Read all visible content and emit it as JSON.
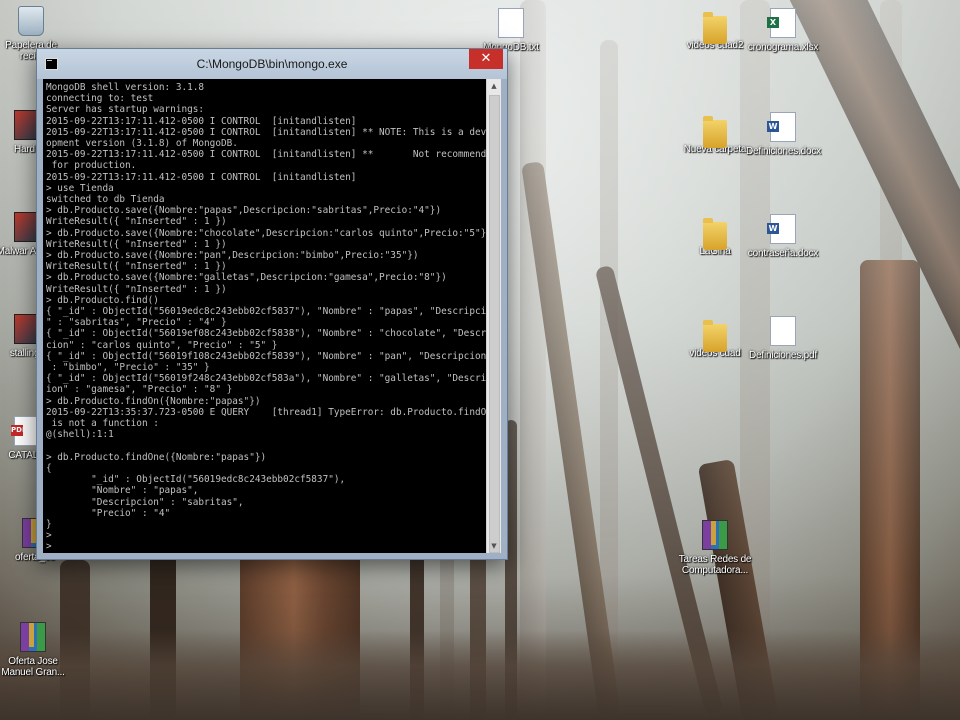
{
  "window": {
    "title": "C:\\MongoDB\\bin\\mongo.exe",
    "close_glyph": "✕",
    "console_lines": [
      "MongoDB shell version: 3.1.8",
      "connecting to: test",
      "Server has startup warnings:",
      "2015-09-22T13:17:11.412-0500 I CONTROL  [initandlisten]",
      "2015-09-22T13:17:11.412-0500 I CONTROL  [initandlisten] ** NOTE: This is a devel",
      "opment version (3.1.8) of MongoDB.",
      "2015-09-22T13:17:11.412-0500 I CONTROL  [initandlisten] **       Not recommended",
      " for production.",
      "2015-09-22T13:17:11.412-0500 I CONTROL  [initandlisten]",
      "> use Tienda",
      "switched to db Tienda",
      "> db.Producto.save({Nombre:\"papas\",Descripcion:\"sabritas\",Precio:\"4\"})",
      "WriteResult({ \"nInserted\" : 1 })",
      "> db.Producto.save({Nombre:\"chocolate\",Descripcion:\"carlos quinto\",Precio:\"5\"})",
      "WriteResult({ \"nInserted\" : 1 })",
      "> db.Producto.save({Nombre:\"pan\",Descripcion:\"bimbo\",Precio:\"35\"})",
      "WriteResult({ \"nInserted\" : 1 })",
      "> db.Producto.save({Nombre:\"galletas\",Descripcion:\"gamesa\",Precio:\"8\"})",
      "WriteResult({ \"nInserted\" : 1 })",
      "> db.Producto.find()",
      "{ \"_id\" : ObjectId(\"56019edc8c243ebb02cf5837\"), \"Nombre\" : \"papas\", \"Descripcion",
      "\" : \"sabritas\", \"Precio\" : \"4\" }",
      "{ \"_id\" : ObjectId(\"56019ef08c243ebb02cf5838\"), \"Nombre\" : \"chocolate\", \"Descrip",
      "cion\" : \"carlos quinto\", \"Precio\" : \"5\" }",
      "{ \"_id\" : ObjectId(\"56019f108c243ebb02cf5839\"), \"Nombre\" : \"pan\", \"Descripcion\"",
      " : \"bimbo\", \"Precio\" : \"35\" }",
      "{ \"_id\" : ObjectId(\"56019f248c243ebb02cf583a\"), \"Nombre\" : \"galletas\", \"Descripc",
      "ion\" : \"gamesa\", \"Precio\" : \"8\" }",
      "> db.Producto.findOn({Nombre:\"papas\"})",
      "2015-09-22T13:35:37.723-0500 E QUERY    [thread1] TypeError: db.Producto.findOn",
      " is not a function :",
      "@(shell):1:1",
      "",
      "> db.Producto.findOne({Nombre:\"papas\"})",
      "{",
      "        \"_id\" : ObjectId(\"56019edc8c243ebb02cf5837\"),",
      "        \"Nombre\" : \"papas\",",
      "        \"Descripcion\" : \"sabritas\",",
      "        \"Precio\" : \"4\"",
      "}",
      "> ",
      "> "
    ]
  },
  "desktop_icons": [
    {
      "label": "Papelera de recicl",
      "type": "bin"
    },
    {
      "label": "Hard I",
      "type": "app"
    },
    {
      "label": "Malwar Anti-M",
      "type": "app"
    },
    {
      "label": "stallings",
      "type": "app"
    },
    {
      "label": "CATALO",
      "type": "pdf"
    },
    {
      "label": "oferta_co",
      "type": "rar"
    },
    {
      "label": "Oferta Jose Manuel Gran...",
      "type": "rar"
    },
    {
      "label": "MongoDB.txt",
      "type": "txt"
    },
    {
      "label": "videos cuad2",
      "type": "folder"
    },
    {
      "label": "cronograma.xlsx",
      "type": "xlsx"
    },
    {
      "label": "Nueva carpeta",
      "type": "folder"
    },
    {
      "label": "Definiciones.docx",
      "type": "docx"
    },
    {
      "label": "LaGina",
      "type": "folder"
    },
    {
      "label": "contraseña.docx",
      "type": "docx"
    },
    {
      "label": "videos cuad",
      "type": "folder"
    },
    {
      "label": "Definiciones.pdf",
      "type": "pdf"
    },
    {
      "label": "Tareas Redes de Computadora...",
      "type": "rar"
    }
  ]
}
